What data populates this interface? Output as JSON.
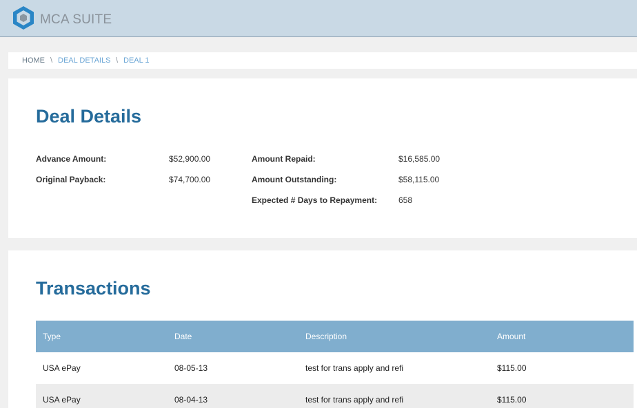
{
  "app": {
    "title": "MCA SUITE",
    "logo_icon": "hexagon-logo-icon",
    "colors": {
      "topbar": "#c9d9e5",
      "heading": "#256b9b",
      "table_header": "#80aece",
      "link": "#6aa5d5"
    }
  },
  "breadcrumb": {
    "items": [
      "HOME",
      "DEAL DETAILS",
      "DEAL 1"
    ],
    "separator": "\\"
  },
  "deal_details": {
    "title": "Deal Details",
    "fields": [
      {
        "label": "Advance Amount:",
        "value": "$52,900.00"
      },
      {
        "label": "Original Payback:",
        "value": "$74,700.00"
      },
      {
        "label": "Amount Repaid:",
        "value": "$16,585.00"
      },
      {
        "label": "Amount Outstanding:",
        "value": "$58,115.00"
      },
      {
        "label": "Expected # Days to Repayment:",
        "value": "658"
      }
    ]
  },
  "transactions": {
    "title": "Transactions",
    "columns": [
      "Type",
      "Date",
      "Description",
      "Amount"
    ],
    "rows": [
      [
        "USA ePay",
        "08-05-13",
        "test for trans apply and refi",
        "$115.00"
      ],
      [
        "USA ePay",
        "08-04-13",
        "test for trans apply and refi",
        "$115.00"
      ]
    ]
  }
}
